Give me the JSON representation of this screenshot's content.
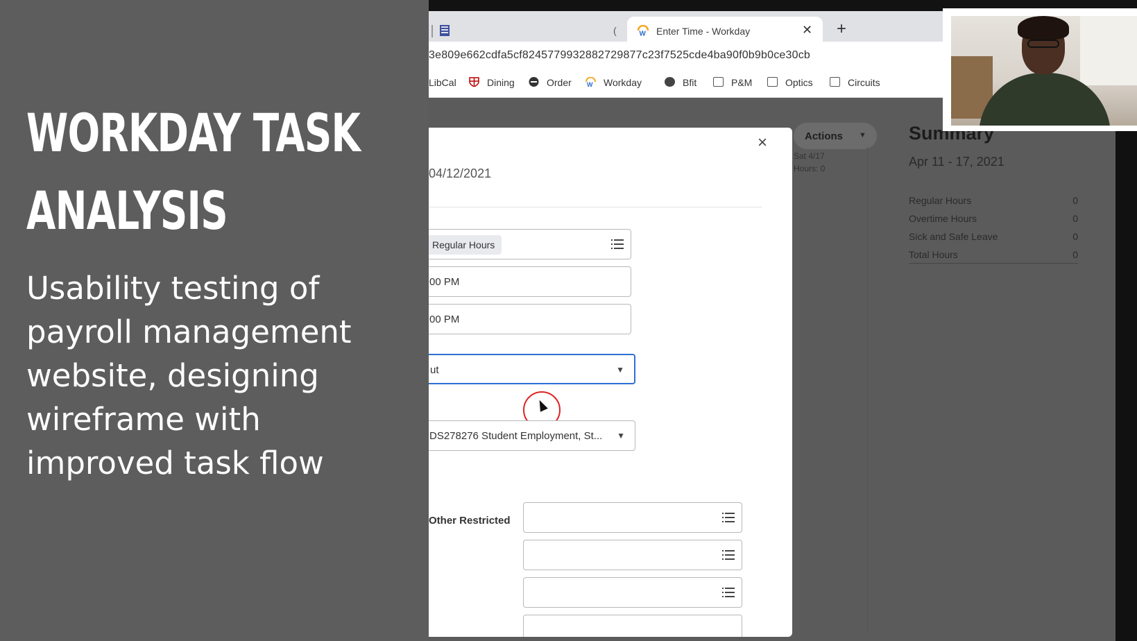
{
  "slide": {
    "title_lines": [
      "WORKDAY TASK",
      "ANALYSIS"
    ],
    "subtitle_lines": [
      "Usability testing of",
      "payroll management",
      "website, designing",
      "wireframe with",
      "improved task flow"
    ]
  },
  "browser": {
    "partial_tab": "(",
    "tab_title": "Enter Time - Workday",
    "tab_close": "✕",
    "new_tab": "+",
    "address": "3e809e662cdfa5cf8245779932882729877c23f7525cde4ba90f0b9b0ce30cb",
    "bookmarks": [
      {
        "label": "LibCal",
        "icon": "partial-icon"
      },
      {
        "label": "Dining",
        "icon": "shield-icon"
      },
      {
        "label": "Order",
        "icon": "get-icon"
      },
      {
        "label": "Workday",
        "icon": "workday-icon"
      },
      {
        "label": "Bfit",
        "icon": "globe-icon"
      },
      {
        "label": "P&M",
        "icon": "folder-icon"
      },
      {
        "label": "Optics",
        "icon": "folder-icon"
      },
      {
        "label": "Circuits",
        "icon": "folder-icon"
      }
    ]
  },
  "workday": {
    "actions_label": "Actions",
    "day_col": [
      "Sat 4/17",
      "Hours: 0"
    ],
    "summary": {
      "title": "Summary",
      "range": "Apr 11 - 17, 2021",
      "rows": [
        {
          "label": "Regular Hours",
          "value": "0"
        },
        {
          "label": "Overtime Hours",
          "value": "0"
        },
        {
          "label": "Sick and Safe Leave",
          "value": "0"
        },
        {
          "label": "Total Hours",
          "value": "0"
        }
      ]
    }
  },
  "modal": {
    "close": "×",
    "date": "04/12/2021",
    "time_type": "Regular Hours",
    "in_time": "00 PM",
    "out_time": "00 PM",
    "out_reason": "ut",
    "position": "DS278276 Student Employment, St...",
    "restricted_label": "Other Restricted"
  },
  "colors": {
    "slide_bg": "#5d5d5d",
    "focus_border": "#2f6fd6",
    "cursor_ring": "#dd2222"
  }
}
